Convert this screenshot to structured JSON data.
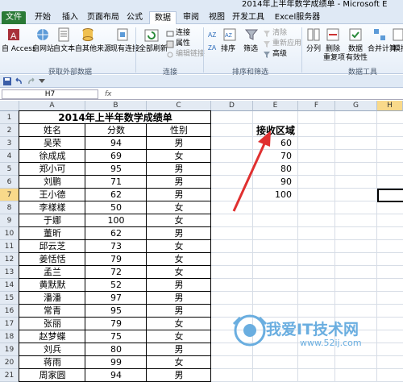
{
  "window": {
    "title": "2014年上半年数学成绩单 - Microsoft E"
  },
  "tabs": [
    "文件",
    "开始",
    "插入",
    "页面布局",
    "公式",
    "数据",
    "审阅",
    "视图",
    "开发工具",
    "Excel服务器"
  ],
  "ribbon": {
    "get_external": {
      "access": "自 Access",
      "web": "自网站",
      "text": "自文本",
      "other": "自其他来源",
      "existing": "现有连接",
      "group": "获取外部数据"
    },
    "connections": {
      "refresh_all": "全部刷新",
      "connections": "连接",
      "properties": "属性",
      "edit_links": "编辑链接",
      "group": "连接"
    },
    "sort_filter": {
      "sort": "排序",
      "filter": "筛选",
      "clear": "清除",
      "reapply": "重新应用",
      "advanced": "高级",
      "group": "排序和筛选"
    },
    "data_tools": {
      "split": "分列",
      "remove_dup_line1": "删除",
      "remove_dup_line2": "重复项",
      "validation_line1": "数据",
      "validation_line2": "有效性",
      "consolidate": "合并计算",
      "whatif": "模拟",
      "group": "数据工具"
    }
  },
  "formula_bar": {
    "name_box": "H7",
    "fx": "fx"
  },
  "columns": [
    "A",
    "B",
    "C",
    "D",
    "E",
    "F",
    "G",
    "H"
  ],
  "rows": [
    "1",
    "2",
    "3",
    "4",
    "5",
    "6",
    "7",
    "8",
    "9",
    "10",
    "11",
    "12",
    "13",
    "14",
    "15",
    "16",
    "17",
    "18",
    "19",
    "20",
    "21"
  ],
  "sheet": {
    "title": "2014年上半年数学成绩单",
    "headers": [
      "姓名",
      "分数",
      "性别"
    ],
    "records": [
      [
        "吴荣",
        "94",
        "男"
      ],
      [
        "徐成成",
        "69",
        "女"
      ],
      [
        "郑小可",
        "95",
        "男"
      ],
      [
        "刘鹏",
        "71",
        "男"
      ],
      [
        "王小德",
        "62",
        "男"
      ],
      [
        "李樣樣",
        "50",
        "女"
      ],
      [
        "于娜",
        "100",
        "女"
      ],
      [
        "董昕",
        "62",
        "男"
      ],
      [
        "邱云芝",
        "73",
        "女"
      ],
      [
        "姜恬恬",
        "79",
        "女"
      ],
      [
        "孟兰",
        "72",
        "女"
      ],
      [
        "黄默默",
        "52",
        "男"
      ],
      [
        "潘潘",
        "97",
        "男"
      ],
      [
        "常青",
        "95",
        "男"
      ],
      [
        "张丽",
        "79",
        "女"
      ],
      [
        "赵梦蝶",
        "75",
        "女"
      ],
      [
        "刘兵",
        "80",
        "男"
      ],
      [
        "蒋雨",
        "99",
        "女"
      ],
      [
        "周家圆",
        "94",
        "男"
      ]
    ],
    "bins_header": "接收区域",
    "bins": [
      "60",
      "70",
      "80",
      "90",
      "100"
    ]
  },
  "watermark": {
    "line1": "我爱IT技术网",
    "line2": "www.52ij.com"
  },
  "colors": {
    "file_tab": "#2a7a36",
    "arrow": "#e03030",
    "watermark": "#6aaee0",
    "selected_header": "#f9d98a"
  }
}
